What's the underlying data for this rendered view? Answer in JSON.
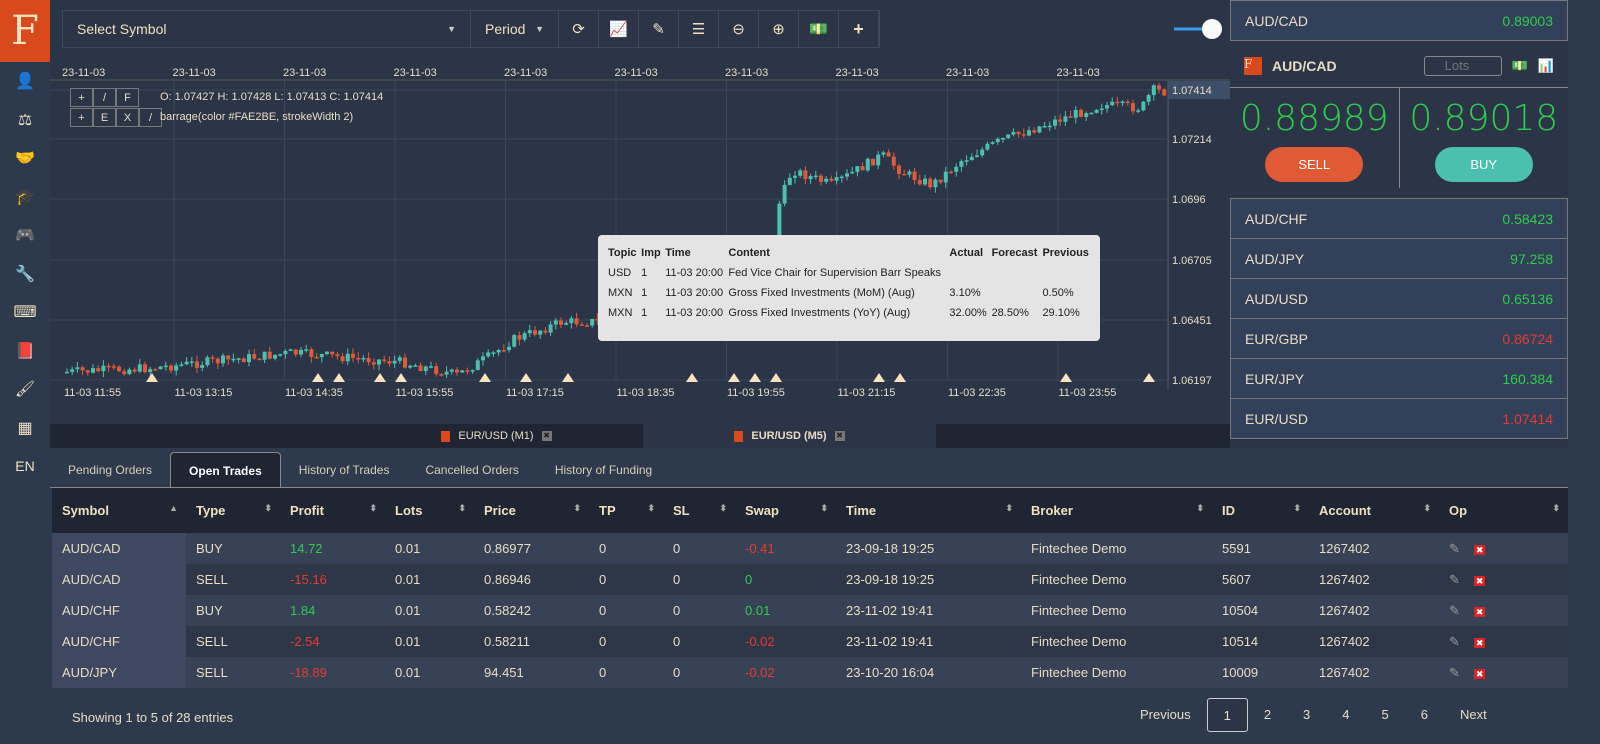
{
  "logo": "F",
  "sidebar": {
    "icons": [
      "user-icon",
      "balance-scale-icon",
      "handshake-icon",
      "graduation-cap-icon",
      "gamepad-icon",
      "wrench-icon",
      "keyboard-icon",
      "book-icon",
      "brush-icon",
      "table-icon"
    ],
    "glyphs": [
      "👤",
      "⚖",
      "🤝",
      "🎓",
      "🎮",
      "🔧",
      "⌨",
      "📕",
      "🖌",
      "▦"
    ],
    "language": "EN"
  },
  "toolbar": {
    "symbol_placeholder": "Select Symbol",
    "period": "Period"
  },
  "chart": {
    "top_dates": [
      "23-11-03",
      "23-11-03",
      "23-11-03",
      "23-11-03",
      "23-11-03",
      "23-11-03",
      "23-11-03",
      "23-11-03",
      "23-11-03",
      "23-11-03"
    ],
    "time_labels": [
      "11-03 11:55",
      "11-03 13:15",
      "11-03 14:35",
      "11-03 15:55",
      "11-03 17:15",
      "11-03 18:35",
      "11-03 19:55",
      "11-03 21:15",
      "11-03 22:35",
      "11-03 23:55"
    ],
    "price_labels": [
      "1.07414",
      "1.07214",
      "1.0696",
      "1.06705",
      "1.06451",
      "1.06197"
    ],
    "ohlc": "O: 1.07427 H: 1.07428 L: 1.07413 C: 1.07414",
    "barrage": "barrage(color #FAE2BE, strokeWidth 2)",
    "buttons_row1": [
      "+",
      "/",
      "F"
    ],
    "buttons_row2": [
      "+",
      "E",
      "X",
      "/"
    ],
    "up_color": "#4bc0b0",
    "down_color": "#e05a35"
  },
  "tooltip": {
    "headers": [
      "Topic",
      "Imp",
      "Time",
      "Content",
      "Actual",
      "Forecast",
      "Previous"
    ],
    "rows": [
      [
        "USD",
        "1",
        "11-03 20:00",
        "Fed Vice Chair for Supervision Barr Speaks",
        "",
        "",
        ""
      ],
      [
        "MXN",
        "1",
        "11-03 20:00",
        "Gross Fixed Investments (MoM) (Aug)",
        "3.10%",
        "",
        "0.50%"
      ],
      [
        "MXN",
        "1",
        "11-03 20:00",
        "Gross Fixed Investments (YoY) (Aug)",
        "32.00%",
        "28.50%",
        "29.10%"
      ]
    ]
  },
  "chart_tabs": [
    {
      "label": "EUR/USD (M1)"
    },
    {
      "label": "EUR/USD (M5)"
    }
  ],
  "tabs": [
    "Pending Orders",
    "Open Trades",
    "History of Trades",
    "Cancelled Orders",
    "History of Funding"
  ],
  "table": {
    "headers": [
      "Symbol",
      "Type",
      "Profit",
      "Lots",
      "Price",
      "TP",
      "SL",
      "Swap",
      "Time",
      "Broker",
      "ID",
      "Account",
      "Op"
    ],
    "rows": [
      [
        "AUD/CAD",
        "BUY",
        "14.72",
        "0.01",
        "0.86977",
        "0",
        "0",
        "-0.41",
        "23-09-18 19:25",
        "Fintechee Demo",
        "5591",
        "1267402"
      ],
      [
        "AUD/CAD",
        "SELL",
        "-15.16",
        "0.01",
        "0.86946",
        "0",
        "0",
        "0",
        "23-09-18 19:25",
        "Fintechee Demo",
        "5607",
        "1267402"
      ],
      [
        "AUD/CHF",
        "BUY",
        "1.84",
        "0.01",
        "0.58242",
        "0",
        "0",
        "0.01",
        "23-11-02 19:41",
        "Fintechee Demo",
        "10504",
        "1267402"
      ],
      [
        "AUD/CHF",
        "SELL",
        "-2.54",
        "0.01",
        "0.58211",
        "0",
        "0",
        "-0.02",
        "23-11-02 19:41",
        "Fintechee Demo",
        "10514",
        "1267402"
      ],
      [
        "AUD/JPY",
        "SELL",
        "-18.89",
        "0.01",
        "94.451",
        "0",
        "0",
        "-0.02",
        "23-10-20 16:04",
        "Fintechee Demo",
        "10009",
        "1267402"
      ]
    ]
  },
  "footer": "Showing 1 to 5 of 28 entries",
  "pager": [
    "Previous",
    "1",
    "2",
    "3",
    "4",
    "5",
    "6",
    "Next"
  ],
  "right": {
    "top": {
      "symbol": "AUD/CAD",
      "price": "0.89003"
    },
    "trade": {
      "symbol": "AUD/CAD",
      "lots_placeholder": "Lots",
      "sell_price": "0.88989",
      "buy_price": "0.89018",
      "sell": "SELL",
      "buy": "BUY",
      "sell_color": "#e05a35",
      "buy_color": "#4bc0b0"
    },
    "quotes": [
      {
        "symbol": "AUD/CHF",
        "price": "0.58423",
        "dir": "up"
      },
      {
        "symbol": "AUD/JPY",
        "price": "97.258",
        "dir": "up"
      },
      {
        "symbol": "AUD/USD",
        "price": "0.65136",
        "dir": "up"
      },
      {
        "symbol": "EUR/GBP",
        "price": "0.86724",
        "dir": "down"
      },
      {
        "symbol": "EUR/JPY",
        "price": "160.384",
        "dir": "up"
      },
      {
        "symbol": "EUR/USD",
        "price": "1.07414",
        "dir": "down"
      }
    ]
  }
}
